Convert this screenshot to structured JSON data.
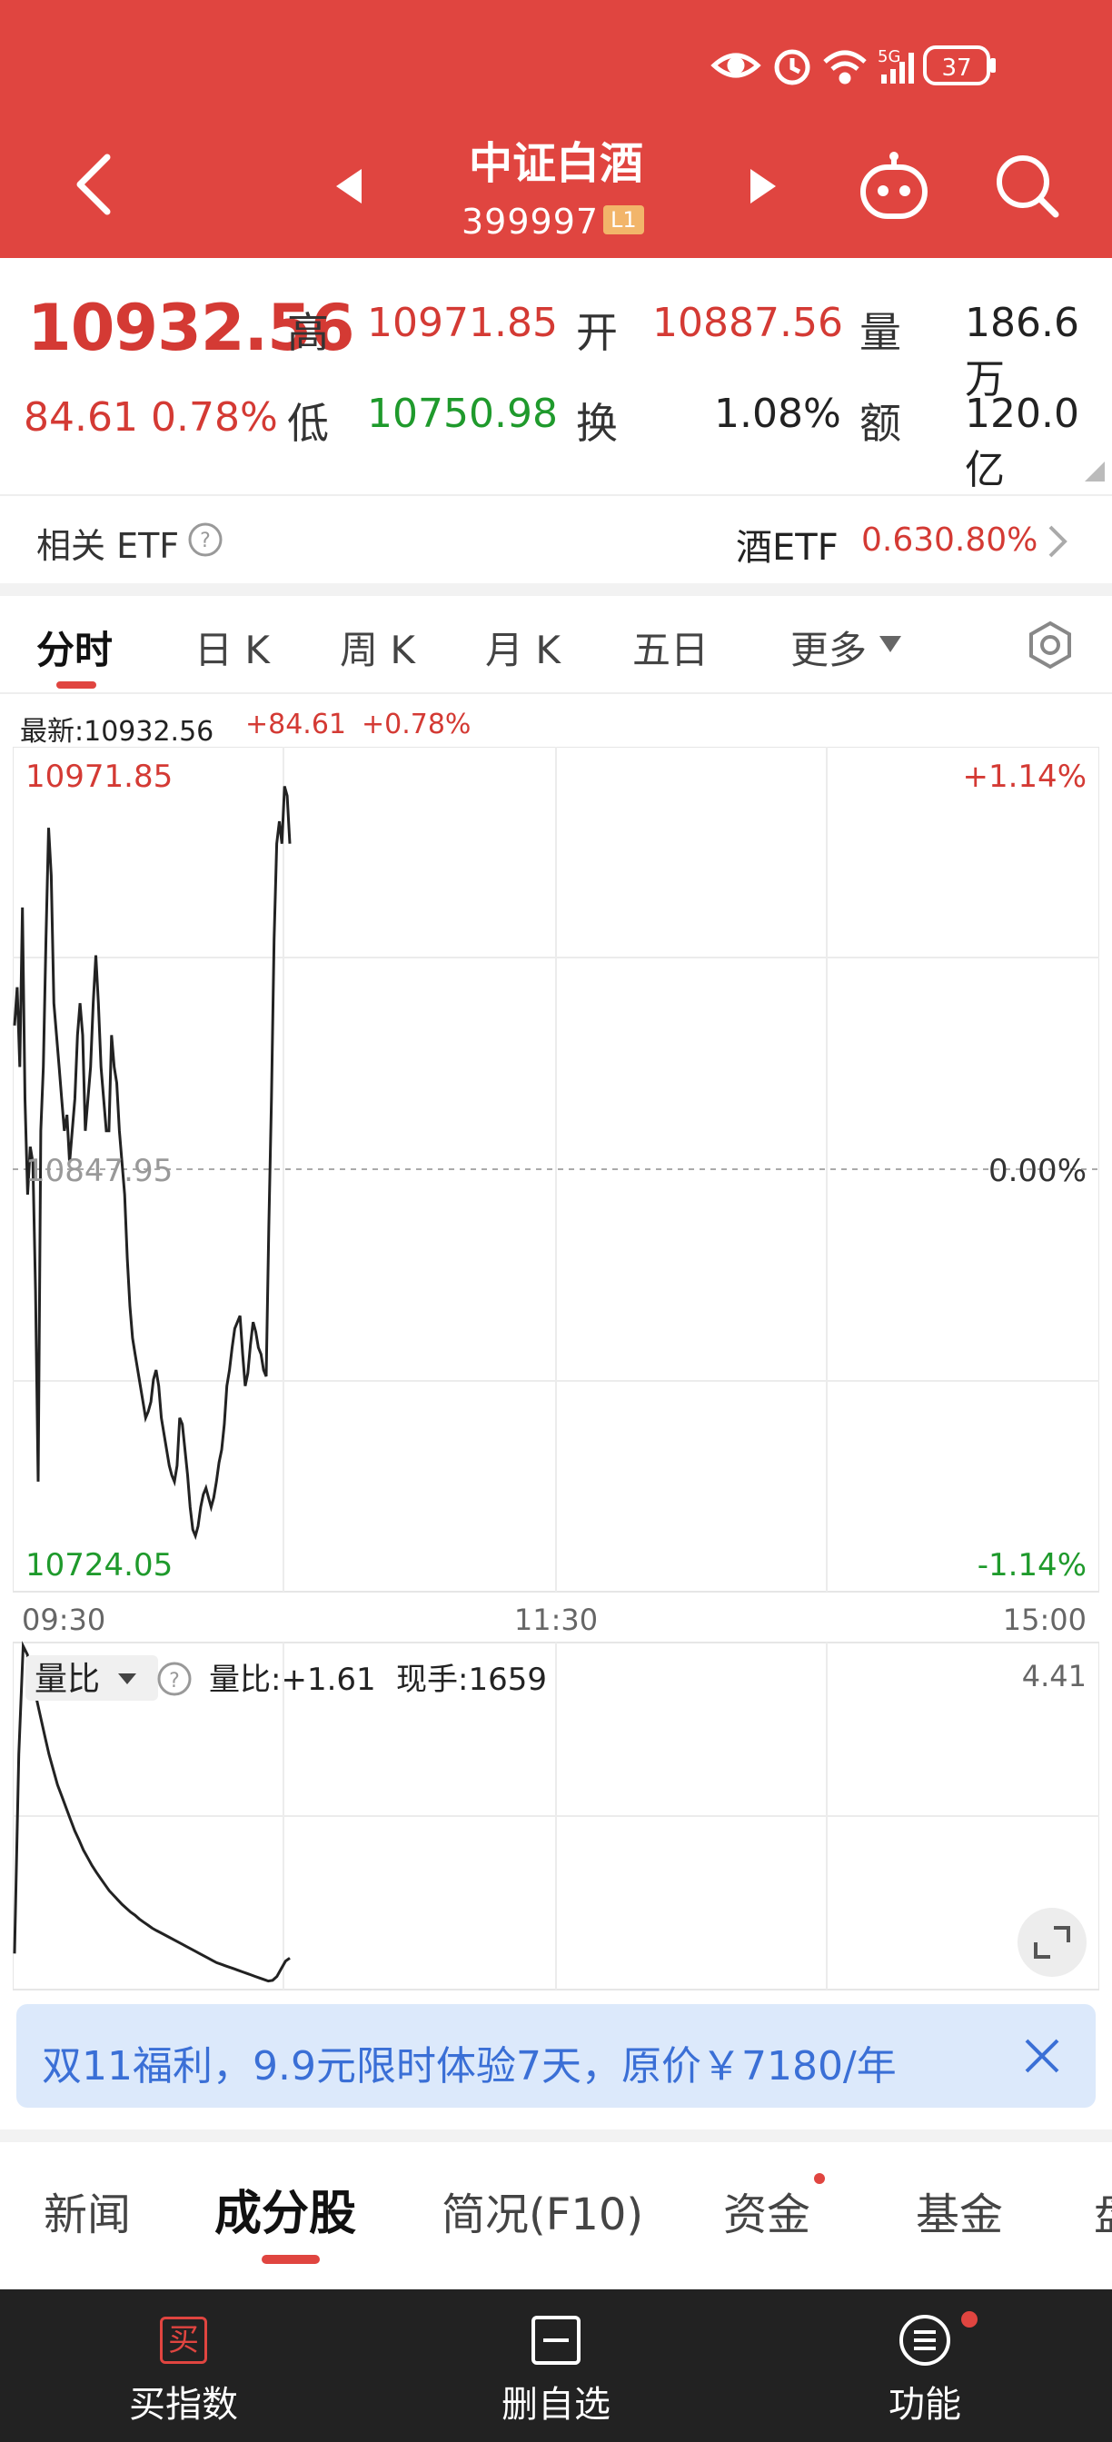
{
  "header": {
    "title": "中证白酒",
    "code": "399997",
    "level_badge": "L1",
    "battery": "37",
    "network": "5G",
    "back_icon": "chevron-left-icon",
    "prev_icon": "triangle-left-icon",
    "next_icon": "triangle-right-icon",
    "assistant_icon": "robot-icon",
    "search_icon": "search-icon"
  },
  "quote": {
    "price": "10932.56",
    "change": "84.61",
    "change_pct": "0.78%",
    "high_label": "高",
    "high": "10971.85",
    "low_label": "低",
    "low": "10750.98",
    "open_label": "开",
    "open": "10887.56",
    "turnover_label": "换",
    "turnover": "1.08%",
    "volume_label": "量",
    "volume": "186.6万",
    "amount_label": "额",
    "amount": "120.0亿"
  },
  "etf": {
    "label": "相关 ETF",
    "name": "酒ETF",
    "change": "0.63",
    "change_pct": "0.80%"
  },
  "ktabs": [
    "分时",
    "日 K",
    "周 K",
    "月 K",
    "五日",
    "更多"
  ],
  "latest": {
    "label": "最新:10932.56",
    "change": "+84.61",
    "change_pct": "+0.78%"
  },
  "chart_data": [
    {
      "type": "line",
      "title": "",
      "x_ticks": [
        "09:30",
        "11:30",
        "15:00"
      ],
      "y_left_ticks": [
        "10971.85",
        "10847.95",
        "10724.05"
      ],
      "y_right_ticks": [
        "+1.14%",
        "0.00%",
        "-1.14%"
      ],
      "ylim": [
        10724.05,
        10971.85
      ],
      "baseline": 10847.95,
      "grid": true,
      "series": [
        {
          "values": [
            10893,
            10905,
            10880,
            10930,
            10870,
            10840,
            10855,
            10850,
            10810,
            10750,
            10860,
            10880,
            10920,
            10955,
            10940,
            10900,
            10890,
            10880,
            10870,
            10860,
            10865,
            10850,
            10860,
            10870,
            10890,
            10900,
            10890,
            10860,
            10870,
            10880,
            10900,
            10915,
            10900,
            10880,
            10870,
            10860,
            10860,
            10890,
            10880,
            10875,
            10860,
            10850,
            10840,
            10820,
            10805,
            10795,
            10790,
            10785,
            10780,
            10775,
            10770,
            10772,
            10775,
            10782,
            10785,
            10780,
            10770,
            10765,
            10760,
            10755,
            10752,
            10750,
            10755,
            10770,
            10768,
            10760,
            10752,
            10742,
            10735,
            10733,
            10736,
            10742,
            10746,
            10748,
            10745,
            10742,
            10745,
            10750,
            10756,
            10760,
            10768,
            10780,
            10785,
            10792,
            10798,
            10800,
            10802,
            10790,
            10780,
            10784,
            10793,
            10800,
            10797,
            10792,
            10790,
            10785,
            10783,
            10830,
            10870,
            10920,
            10950,
            10957,
            10950,
            10968,
            10965,
            10950
          ]
        }
      ]
    },
    {
      "type": "line",
      "title": "",
      "x_ticks": [],
      "y_right_ticks": [
        "4.41"
      ],
      "ylim": [
        0,
        4.41
      ],
      "grid": true,
      "series": [
        {
          "name": "量比",
          "values": [
            0.4,
            3.0,
            4.41,
            4.3,
            4.0,
            3.75,
            3.5,
            3.25,
            3.0,
            2.8,
            2.6,
            2.45,
            2.3,
            2.15,
            2.0,
            1.88,
            1.75,
            1.65,
            1.55,
            1.46,
            1.38,
            1.3,
            1.22,
            1.16,
            1.1,
            1.04,
            0.99,
            0.94,
            0.9,
            0.85,
            0.81,
            0.77,
            0.73,
            0.7,
            0.67,
            0.64,
            0.61,
            0.58,
            0.55,
            0.52,
            0.49,
            0.46,
            0.43,
            0.4,
            0.37,
            0.34,
            0.31,
            0.28,
            0.26,
            0.24,
            0.22,
            0.2,
            0.18,
            0.16,
            0.14,
            0.12,
            0.1,
            0.08,
            0.06,
            0.04,
            0.05,
            0.1,
            0.2,
            0.3,
            0.34
          ]
        }
      ]
    }
  ],
  "sub_chart": {
    "indicator": "量比",
    "ratio_text": "量比:+1.61",
    "hand_text": "现手:1659"
  },
  "promo": {
    "text": "双11福利，9.9元限时体验7天，原价￥7180/年"
  },
  "bottom_tabs": [
    "新闻",
    "成分股",
    "简况(F10)",
    "资金",
    "基金",
    "盘"
  ],
  "bottom_bar": {
    "buy_label": "买指数",
    "buy_icon_text": "买",
    "remove_label": "删自选",
    "func_label": "功能"
  },
  "colors": {
    "header_red": "#e04540",
    "up_red": "#d43a34",
    "down_green": "#1f9a2c",
    "promo_bg": "#dce9fb",
    "promo_text": "#3a6fd6"
  }
}
